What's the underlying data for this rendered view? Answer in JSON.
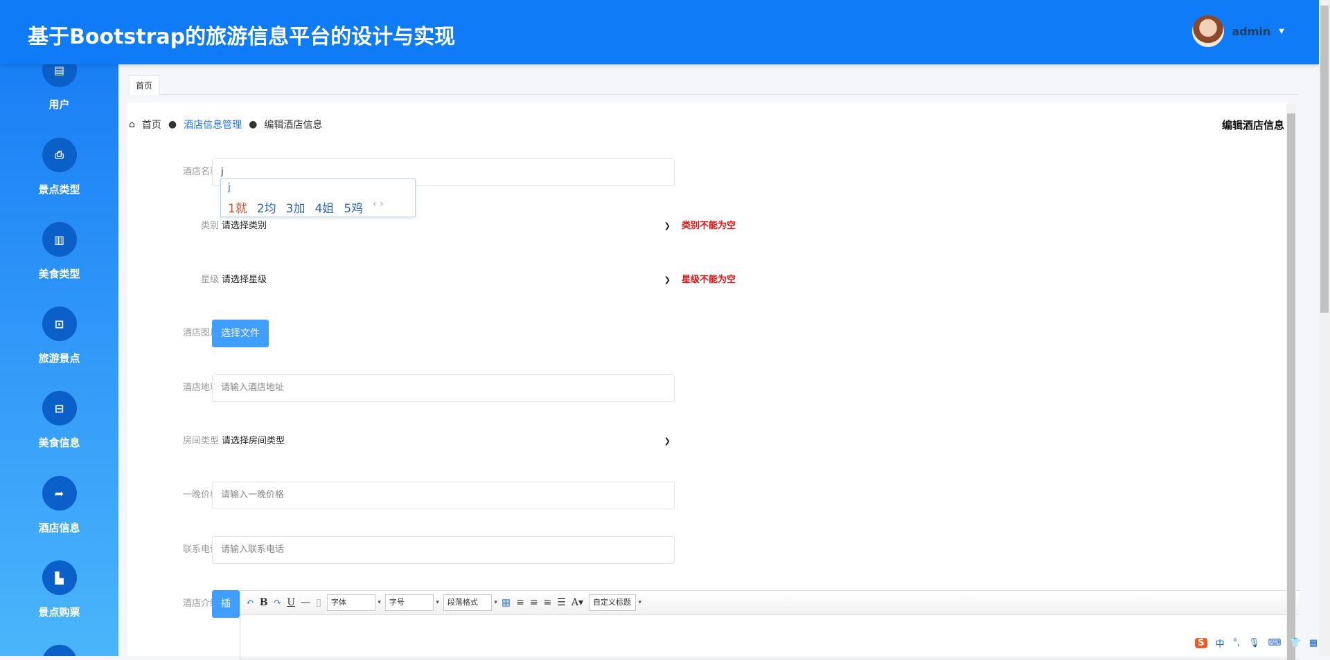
{
  "header": {
    "title": "基于Bootstrap的旅游信息平台的设计与实现",
    "username": "admin"
  },
  "sidebar": {
    "items": [
      {
        "label": "用户",
        "icon": "▤"
      },
      {
        "label": "景点类型",
        "icon": "⎙"
      },
      {
        "label": "美食类型",
        "icon": "▥"
      },
      {
        "label": "旅游景点",
        "icon": "⊡"
      },
      {
        "label": "美食信息",
        "icon": "⊟"
      },
      {
        "label": "酒店信息",
        "icon": "➦"
      },
      {
        "label": "景点购票",
        "icon": "▙"
      }
    ]
  },
  "tabs": [
    {
      "label": "首页"
    }
  ],
  "breadcrumb": {
    "home": "首页",
    "section": "酒店信息管理",
    "current": "编辑酒店信息"
  },
  "page_title": "编辑酒店信息",
  "form": {
    "name": {
      "label": "酒店名称",
      "value": "j"
    },
    "category": {
      "label": "类别",
      "value": "请选择类别",
      "error": "类别不能为空"
    },
    "star": {
      "label": "星级",
      "value": "请选择星级",
      "error": "星级不能为空"
    },
    "image": {
      "label": "酒店图片",
      "button": "选择文件"
    },
    "address": {
      "label": "酒店地址",
      "placeholder": "请输入酒店地址"
    },
    "room_type": {
      "label": "房间类型",
      "value": "请选择房间类型"
    },
    "price": {
      "label": "一晚价格",
      "placeholder": "请输入一晚价格"
    },
    "phone": {
      "label": "联系电话",
      "placeholder": "请输入联系电话"
    },
    "intro": {
      "label": "酒店介绍",
      "insert": "插"
    }
  },
  "editor": {
    "font": "字体",
    "size": "字号",
    "paragraph": "段落格式",
    "custom": "自定义标题"
  },
  "ime": {
    "typed": "j",
    "candidates": [
      "1就",
      "2均",
      "3加",
      "4姐",
      "5鸡"
    ]
  },
  "tray": [
    "中",
    "°,"
  ]
}
